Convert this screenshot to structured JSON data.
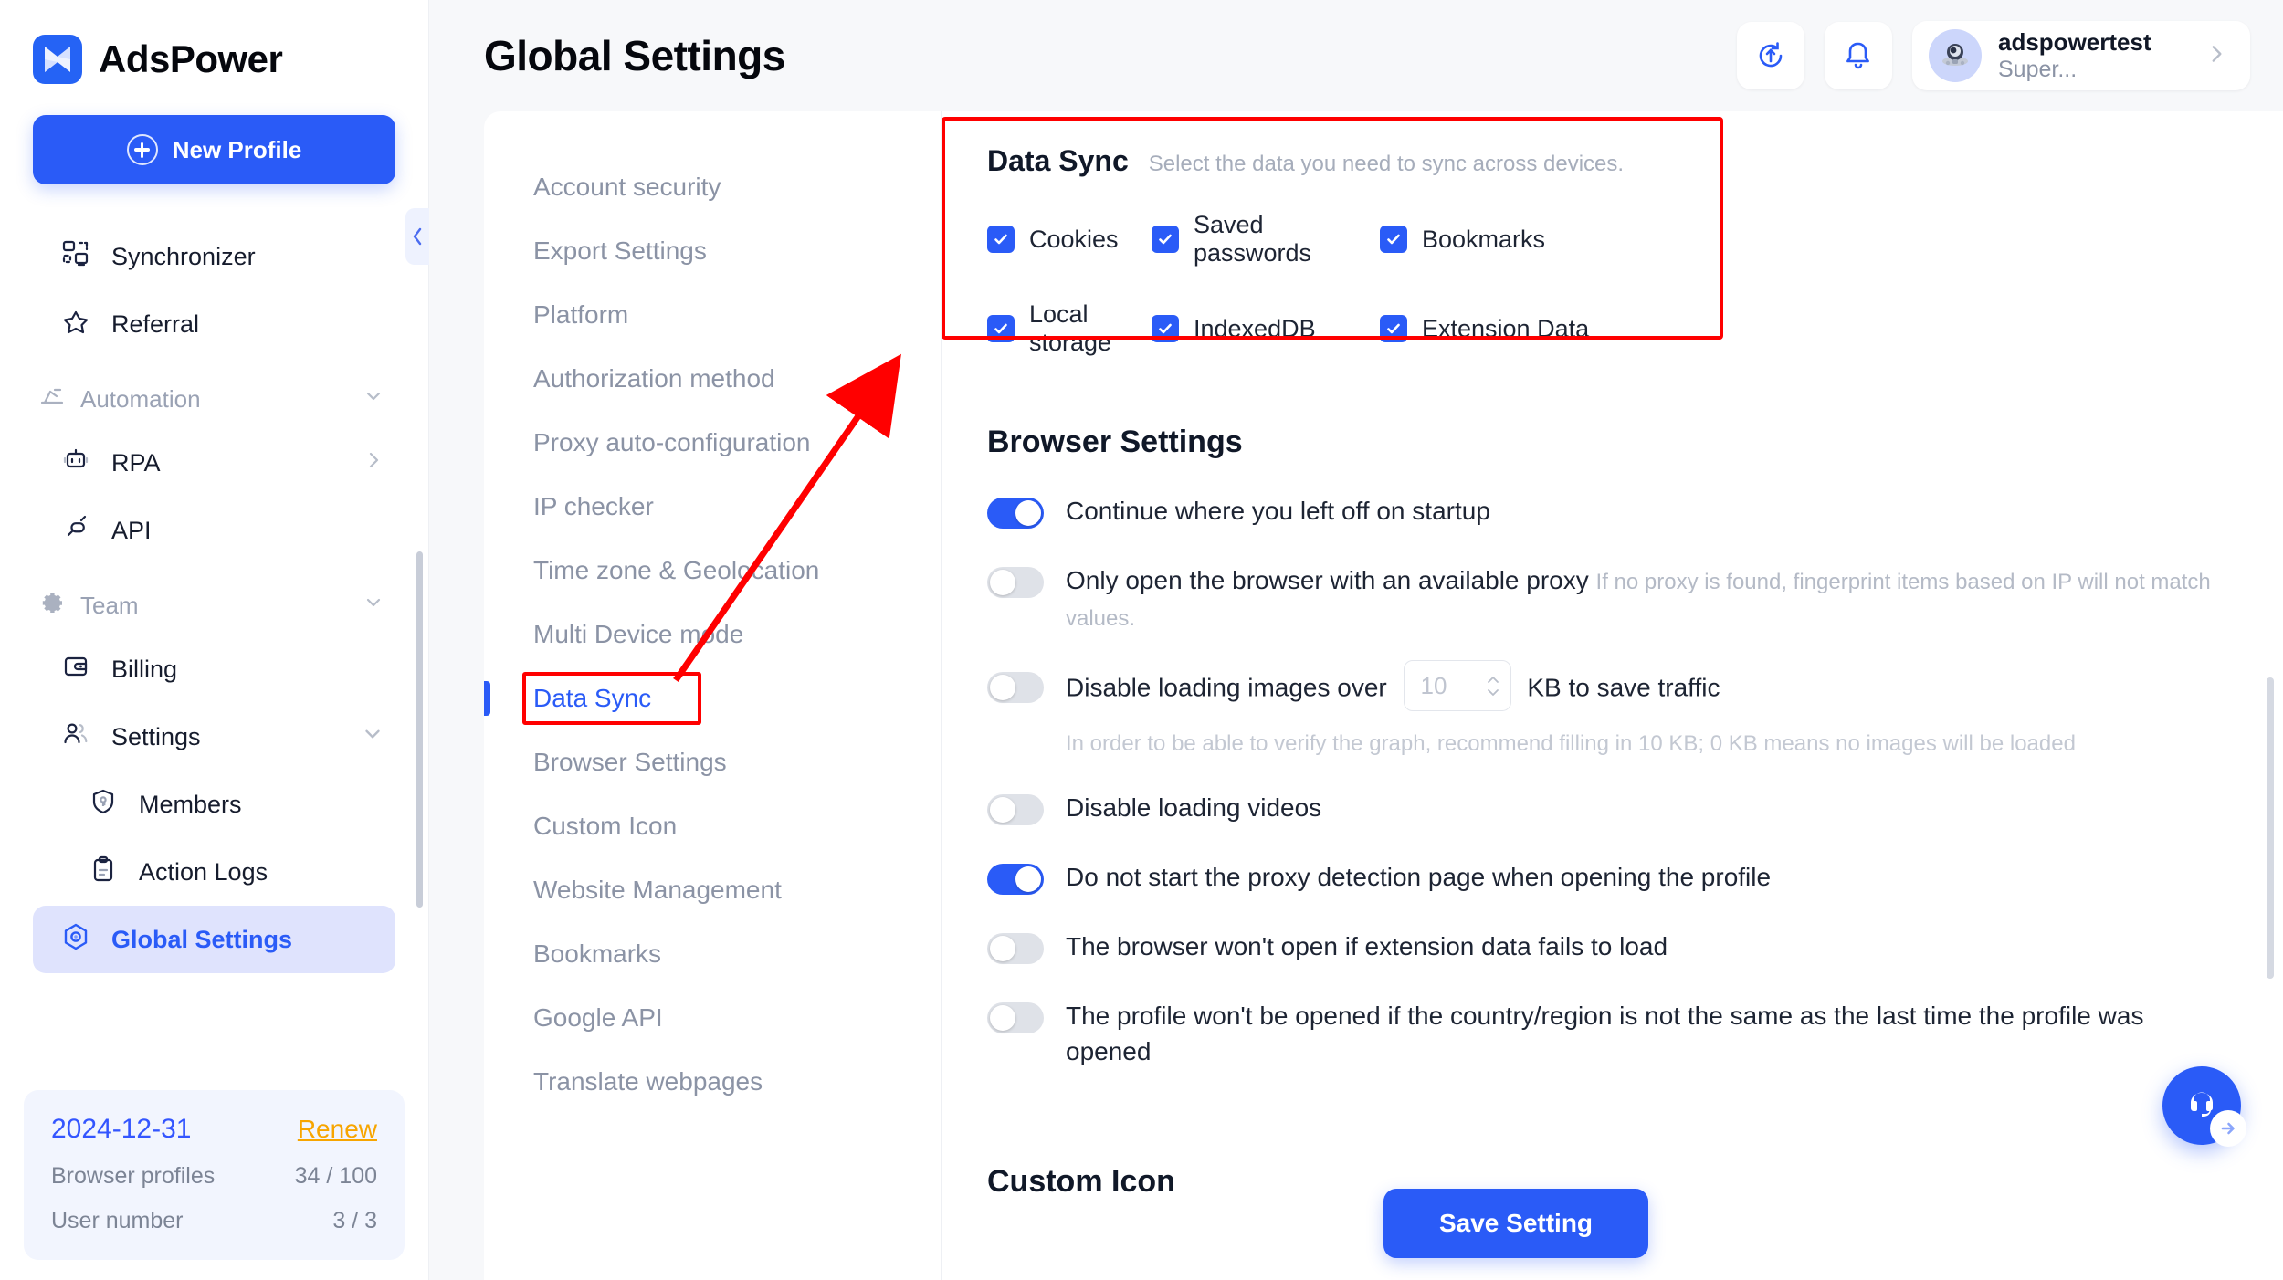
{
  "brand": {
    "name": "AdsPower",
    "logo_icon": "adspower-logo-icon"
  },
  "sidebar": {
    "new_profile_label": "New Profile",
    "items": [
      {
        "label": "Synchronizer",
        "icon": "synchronizer-icon"
      },
      {
        "label": "Referral",
        "icon": "star-icon"
      }
    ],
    "groups": [
      {
        "label": "Automation",
        "icon": "automation-icon",
        "items": [
          {
            "label": "RPA",
            "icon": "robot-icon",
            "chevron": "chevron-right"
          },
          {
            "label": "API",
            "icon": "plug-icon"
          }
        ]
      },
      {
        "label": "Team",
        "icon": "gear-icon",
        "items": [
          {
            "label": "Billing",
            "icon": "wallet-icon"
          },
          {
            "label": "Settings",
            "icon": "users-icon",
            "chevron": "chevron-down"
          },
          {
            "label": "Members",
            "icon": "shield-key-icon",
            "sub": true
          },
          {
            "label": "Action Logs",
            "icon": "clipboard-icon",
            "sub": true
          },
          {
            "label": "Global Settings",
            "icon": "hexagon-target-icon",
            "active": true
          }
        ]
      }
    ],
    "plan": {
      "expiry_date": "2024-12-31",
      "renew_label": "Renew",
      "rows": [
        {
          "label": "Browser profiles",
          "value": "34 / 100"
        },
        {
          "label": "User number",
          "value": "3 / 3"
        }
      ]
    },
    "collapse_icon": "chevron-left-icon"
  },
  "header": {
    "title": "Global Settings",
    "sync_icon": "sync-upload-icon",
    "bell_icon": "bell-icon",
    "user": {
      "name": "adspowertest",
      "role": "Super...",
      "avatar_icon": "astronaut-avatar-icon",
      "chevron_icon": "chevron-right-icon"
    }
  },
  "settings_menu": {
    "items": [
      {
        "label": "Account security"
      },
      {
        "label": "Export Settings"
      },
      {
        "label": "Platform"
      },
      {
        "label": "Authorization method"
      },
      {
        "label": "Proxy auto-configuration"
      },
      {
        "label": "IP checker"
      },
      {
        "label": "Time zone & Geolocation"
      },
      {
        "label": "Multi Device mode"
      },
      {
        "label": "Data Sync",
        "active": true,
        "highlighted": true
      },
      {
        "label": "Browser Settings"
      },
      {
        "label": "Custom Icon"
      },
      {
        "label": "Website Management"
      },
      {
        "label": "Bookmarks"
      },
      {
        "label": "Google API"
      },
      {
        "label": "Translate webpages"
      }
    ]
  },
  "data_sync": {
    "title": "Data Sync",
    "subtitle": "Select the data you need to sync across devices.",
    "options": [
      {
        "label": "Cookies",
        "checked": true
      },
      {
        "label": "Saved passwords",
        "checked": true
      },
      {
        "label": "Bookmarks",
        "checked": true
      },
      {
        "label": "Local storage",
        "checked": true
      },
      {
        "label": "IndexedDB",
        "checked": true
      },
      {
        "label": "Extension Data",
        "checked": true
      }
    ]
  },
  "browser_settings": {
    "title": "Browser Settings",
    "rows": [
      {
        "label": "Continue where you left off on startup",
        "on": true
      },
      {
        "label": "Only open the browser with an available proxy",
        "hint": "If no proxy is found, fingerprint items based on IP will not match values.",
        "on": false
      },
      {
        "label_before": "Disable loading images over",
        "label_after": "KB to save traffic",
        "stepper_value": "10",
        "note": "In order to be able to verify the graph, recommend filling in 10 KB; 0 KB means no images will be loaded",
        "on": false
      },
      {
        "label": "Disable loading videos",
        "on": false
      },
      {
        "label": "Do not start the proxy detection page when opening the profile",
        "on": true
      },
      {
        "label": "The browser won't open if extension data fails to load",
        "on": false
      },
      {
        "label": "The profile won't be opened if the country/region is not the same as the last time the profile was opened",
        "on": false
      }
    ]
  },
  "custom_icon": {
    "title": "Custom Icon"
  },
  "footer": {
    "save_label": "Save Setting"
  },
  "support": {
    "icon": "headset-icon",
    "badge_icon": "arrow-right-icon"
  },
  "colors": {
    "accent": "#2a5bf7",
    "annotation": "#ff0000",
    "renew": "#f7a500",
    "muted": "#8b93a5"
  }
}
